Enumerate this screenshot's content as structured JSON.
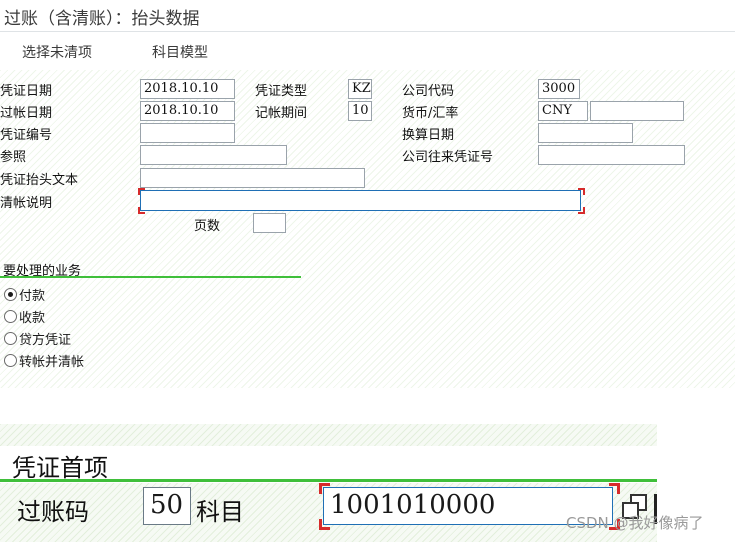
{
  "window": {
    "title": "过账（含清账）：抬头数据"
  },
  "toolbar": {
    "select_open_items": "选择未清项",
    "account_model": "科目模型"
  },
  "header": {
    "doc_date_label": "凭证日期",
    "doc_date": "2018.10.10",
    "doc_type_label": "凭证类型",
    "doc_type": "KZ",
    "company_code_label": "公司代码",
    "company_code": "3000",
    "posting_date_label": "过帐日期",
    "posting_date": "2018.10.10",
    "period_label": "记帐期间",
    "period": "10",
    "currency_label": "货币/汇率",
    "currency": "CNY",
    "exchange_rate": "",
    "doc_number_label": "凭证编号",
    "doc_number": "",
    "translation_date_label": "换算日期",
    "translation_date": "",
    "reference_label": "参照",
    "reference": "",
    "intercompany_label": "公司往来凭证号",
    "intercompany": "",
    "header_text_label": "凭证抬头文本",
    "header_text": "",
    "clearing_text_label": "清帐说明",
    "clearing_text": "",
    "page_label": "页数",
    "page": ""
  },
  "transaction": {
    "title": "要处理的业务",
    "options": [
      "付款",
      "收款",
      "贷方凭证",
      "转帐并清帐"
    ],
    "selected": "付款"
  },
  "first_item": {
    "title": "凭证首项",
    "posting_key_label": "过账码",
    "posting_key": "50",
    "account_label": "科目",
    "account": "1001010000"
  },
  "watermark": "CSDN @我好像病了"
}
